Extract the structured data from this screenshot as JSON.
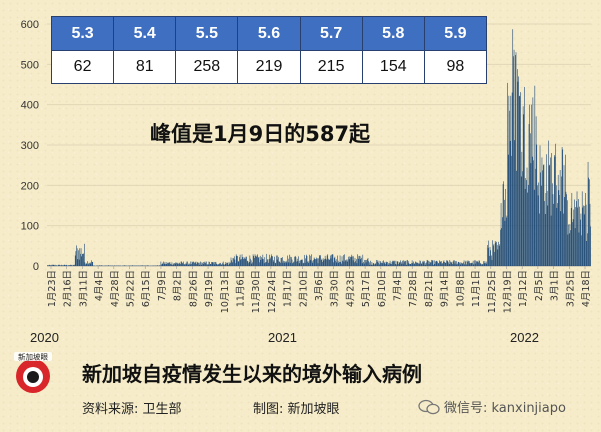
{
  "table": {
    "dates": [
      "5.3",
      "5.4",
      "5.5",
      "5.6",
      "5.7",
      "5.8",
      "5.9"
    ],
    "counts": [
      "62",
      "81",
      "258",
      "219",
      "215",
      "154",
      "98"
    ]
  },
  "peak_note": "峰值是1月9日的587起",
  "years": [
    "2020",
    "2021",
    "2022"
  ],
  "footer": {
    "title": "新加坡自疫情发生以来的境外输入病例",
    "source": "资料来源:   卫生部",
    "made_by": "制图:   新加坡眼",
    "wechat": "微信号: kanxinjiapo"
  },
  "logo_text": "新加坡眼",
  "colors": {
    "bars": "#1e4a78",
    "table_header": "#3f6fc0",
    "table_border": "#27406f"
  },
  "chart_data": {
    "type": "bar",
    "title": "新加坡自疫情发生以来的境外输入病例",
    "ylim": [
      0,
      600
    ],
    "yticks": [
      0,
      100,
      200,
      300,
      400,
      500,
      600
    ],
    "x_start": "2020-01-23",
    "x_end": "2022-05-09",
    "xtick_labels": [
      "1月23日",
      "2月16日",
      "3月11日",
      "4月4日",
      "4月28日",
      "5月22日",
      "6月15日",
      "7月9日",
      "8月2日",
      "8月26日",
      "9月19日",
      "10月13日",
      "11月6日",
      "11月30日",
      "12月24日",
      "1月17日",
      "2月10日",
      "3月6日",
      "3月30日",
      "4月23日",
      "5月17日",
      "6月10日",
      "7月4日",
      "7月28日",
      "8月21日",
      "9月14日",
      "10月8日",
      "11月1日",
      "11月25日",
      "12月19日",
      "1月12日",
      "2月5日",
      "3月1日",
      "3月25日",
      "4月18日"
    ],
    "year_labels": [
      "2020",
      "2021",
      "2022"
    ],
    "peak": {
      "date": "2022-01-09",
      "value": 587
    },
    "segments": [
      {
        "from": "2020-01-23",
        "to": "2020-03-05",
        "level": 2
      },
      {
        "from": "2020-03-06",
        "to": "2020-03-20",
        "level": 35
      },
      {
        "from": "2020-03-21",
        "to": "2020-04-02",
        "level": 10
      },
      {
        "from": "2020-04-03",
        "to": "2020-07-15",
        "level": 1
      },
      {
        "from": "2020-07-16",
        "to": "2020-10-31",
        "level": 7
      },
      {
        "from": "2020-11-01",
        "to": "2021-05-31",
        "level": 18
      },
      {
        "from": "2021-06-01",
        "to": "2021-11-30",
        "level": 9
      },
      {
        "from": "2021-12-01",
        "to": "2021-12-20",
        "level": 40
      },
      {
        "from": "2021-12-21",
        "to": "2021-12-31",
        "level": 160
      },
      {
        "from": "2022-01-01",
        "to": "2022-01-20",
        "level": 390
      },
      {
        "from": "2022-01-21",
        "to": "2022-02-15",
        "level": 330
      },
      {
        "from": "2022-02-16",
        "to": "2022-03-31",
        "level": 220
      },
      {
        "from": "2022-04-01",
        "to": "2022-04-30",
        "level": 130
      },
      {
        "from": "2022-05-01",
        "to": "2022-05-09",
        "level": 160
      }
    ],
    "highlights": [
      {
        "date": "2022-05-03",
        "value": 62
      },
      {
        "date": "2022-05-04",
        "value": 81
      },
      {
        "date": "2022-05-05",
        "value": 258
      },
      {
        "date": "2022-05-06",
        "value": 219
      },
      {
        "date": "2022-05-07",
        "value": 215
      },
      {
        "date": "2022-05-08",
        "value": 154
      },
      {
        "date": "2022-05-09",
        "value": 98
      }
    ]
  }
}
